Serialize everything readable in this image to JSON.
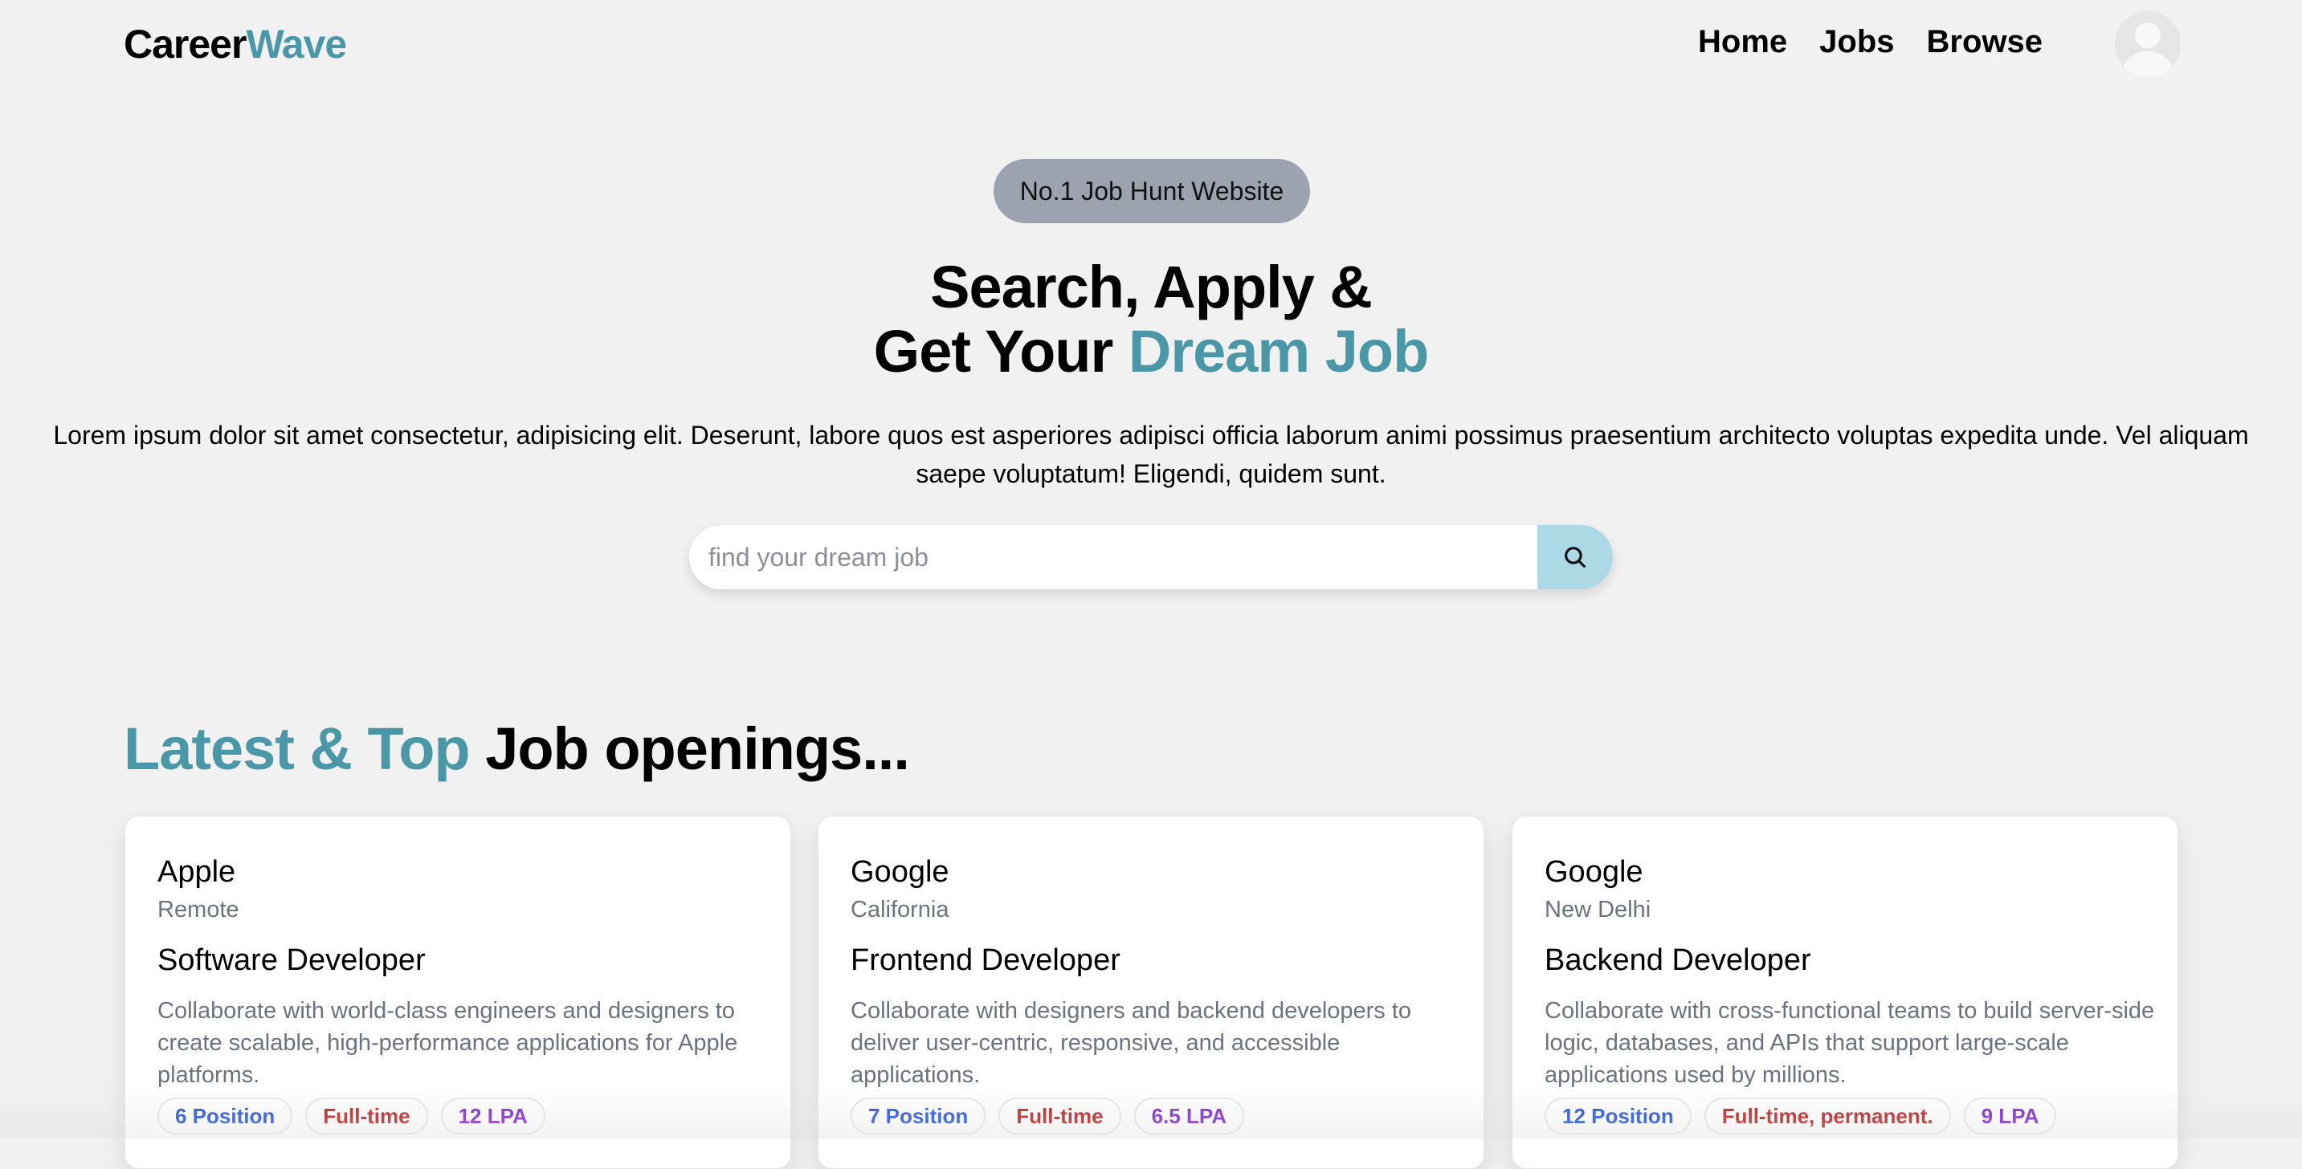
{
  "brand": {
    "part1": "Career",
    "part2": "Wave"
  },
  "nav": {
    "links": [
      "Home",
      "Jobs",
      "Browse"
    ]
  },
  "hero": {
    "badge": "No.1 Job Hunt Website",
    "title_line1": "Search, Apply &",
    "title_line2_plain": "Get Your ",
    "title_line2_accent": "Dream Job",
    "description": "Lorem ipsum dolor sit amet consectetur, adipisicing elit. Deserunt, labore quos est asperiores adipisci officia laborum animi possimus praesentium architecto voluptas expedita unde. Vel aliquam saepe voluptatum! Eligendi, quidem sunt.",
    "search_placeholder": "find your dream job",
    "search_value": ""
  },
  "section": {
    "title_accent": "Latest & Top",
    "title_plain": " Job openings..."
  },
  "jobs": [
    {
      "company": "Apple",
      "location": "Remote",
      "role": "Software Developer",
      "description": "Collaborate with world-class engineers and designers to create scalable, high-performance applications for Apple platforms.",
      "positions": "6 Position",
      "type": "Full-time",
      "salary": "12 LPA"
    },
    {
      "company": "Google",
      "location": "California",
      "role": "Frontend Developer",
      "description": "Collaborate with designers and backend developers to deliver user-centric, responsive, and accessible applications.",
      "positions": "7 Position",
      "type": "Full-time",
      "salary": "6.5 LPA"
    },
    {
      "company": "Google",
      "location": "New Delhi",
      "role": "Backend Developer",
      "description": "Collaborate with cross-functional teams to build server-side logic, databases, and APIs that support large-scale applications used by millions.",
      "positions": "12 Position",
      "type": "Full-time, permanent.",
      "salary": "9 LPA"
    }
  ],
  "colors": {
    "accent": "#4a97a8",
    "search_button": "#add8e6",
    "badge_bg": "#9ca3af"
  },
  "icons": {
    "search": "search-icon",
    "avatar": "user-avatar-icon"
  }
}
